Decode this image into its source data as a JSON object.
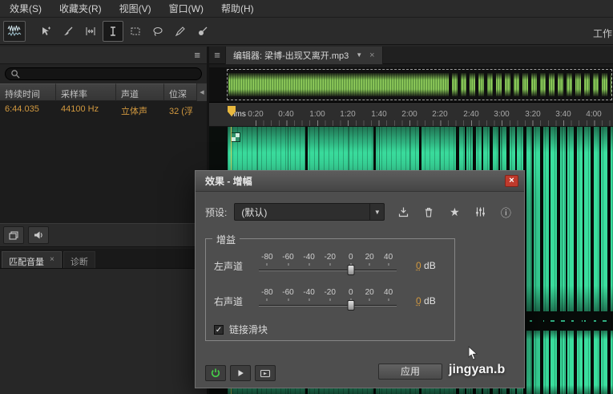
{
  "menu": {
    "items": [
      "效果(S)",
      "收藏夹(R)",
      "视图(V)",
      "窗口(W)",
      "帮助(H)"
    ]
  },
  "workspace": {
    "label": "工作"
  },
  "files": {
    "search_value": "",
    "columns": [
      "持续时间",
      "采样率",
      "声道",
      "位深"
    ],
    "row": [
      "6:44.035",
      "44100 Hz",
      "立体声",
      "32 (浮"
    ]
  },
  "lower_tabs": [
    {
      "label": "匹配音量"
    },
    {
      "label": "诊断"
    }
  ],
  "editor": {
    "tab_label": "编辑器: 梁博-出现又离开.mp3",
    "ruler_unit": "hms",
    "ticks": [
      "0:20",
      "0:40",
      "1:00",
      "1:20",
      "1:40",
      "2:00",
      "2:20",
      "2:40",
      "3:00",
      "3:20",
      "3:40",
      "4:00"
    ]
  },
  "dialog": {
    "title": "效果 - 增幅",
    "preset": {
      "label": "预设:",
      "value": "(默认)"
    },
    "gain": {
      "group_label": "增益",
      "scale": [
        "-80",
        "-60",
        "-40",
        "-20",
        "0",
        "20",
        "40"
      ],
      "channels": [
        {
          "label": "左声道",
          "value": "0",
          "unit": " dB"
        },
        {
          "label": "右声道",
          "value": "0",
          "unit": " dB"
        }
      ],
      "link_label": "链接滑块",
      "link_checked": true
    },
    "apply_label": "应用"
  },
  "watermark": {
    "text": "jingyan.b"
  },
  "icons": {
    "close_glyph": "×",
    "dropdown_glyph": "▼",
    "star_glyph": "★",
    "info_glyph": "ⓘ",
    "check_glyph": "✓",
    "panel_menu_glyph": "≡",
    "scroll_left_glyph": "◀"
  },
  "colors": {
    "waveform_green": "#3ade9e",
    "value_orange": "#d2993f",
    "close_red": "#bf3a2c",
    "power_green": "#46d24a",
    "playhead_yellow": "#e9b93e"
  }
}
